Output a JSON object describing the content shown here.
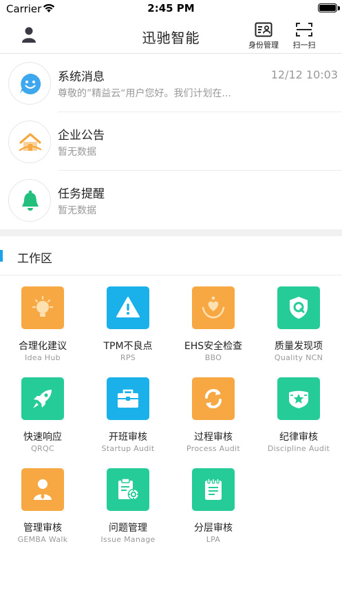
{
  "status_bar": {
    "carrier": "Carrier",
    "time": "2:45 PM"
  },
  "header": {
    "title": "迅驰智能",
    "identity_label": "身份管理",
    "scan_label": "扫一扫"
  },
  "colors": {
    "accent": "#1aa3ea",
    "orange": "#f7a843",
    "blue": "#1ab0ea",
    "green": "#25cc98",
    "message_blue": "#3fa7ee",
    "bell_green": "#22bf7d"
  },
  "messages": [
    {
      "title": "系统消息",
      "subtitle": "尊敬的”精益云“用户您好。我们计划在...",
      "time": "12/12 10:03",
      "icon": "chat-smile-icon"
    },
    {
      "title": "企业公告",
      "subtitle": "暂无数据",
      "time": "",
      "icon": "house-icon"
    },
    {
      "title": "任务提醒",
      "subtitle": "暂无数据",
      "time": "",
      "icon": "bell-icon"
    }
  ],
  "workspace": {
    "title": "工作区",
    "tiles": [
      {
        "label": "合理化建议",
        "sub": "Idea Hub",
        "icon": "lightbulb-icon",
        "color": "orange"
      },
      {
        "label": "TPM不良点",
        "sub": "RPS",
        "icon": "warning-icon",
        "color": "blue"
      },
      {
        "label": "EHS安全检查",
        "sub": "BBO",
        "icon": "icare-hands-icon",
        "color": "orange"
      },
      {
        "label": "质量发现项",
        "sub": "Quality NCN",
        "icon": "quality-shield-icon",
        "color": "green"
      },
      {
        "label": "快速响应",
        "sub": "QRQC",
        "icon": "rocket-icon",
        "color": "green"
      },
      {
        "label": "开班审核",
        "sub": "Startup Audit",
        "icon": "toolbox-icon",
        "color": "blue"
      },
      {
        "label": "过程审核",
        "sub": "Process Audit",
        "icon": "refresh-icon",
        "color": "orange"
      },
      {
        "label": "纪律审核",
        "sub": "Discipline Audit",
        "icon": "badge-star-icon",
        "color": "green"
      },
      {
        "label": "管理审核",
        "sub": "GEMBA Walk",
        "icon": "manager-icon",
        "color": "orange"
      },
      {
        "label": "问题管理",
        "sub": "Issue Manage",
        "icon": "clipboard-gear-icon",
        "color": "green"
      },
      {
        "label": "分层审核",
        "sub": "LPA",
        "icon": "notepad-icon",
        "color": "green"
      }
    ]
  }
}
